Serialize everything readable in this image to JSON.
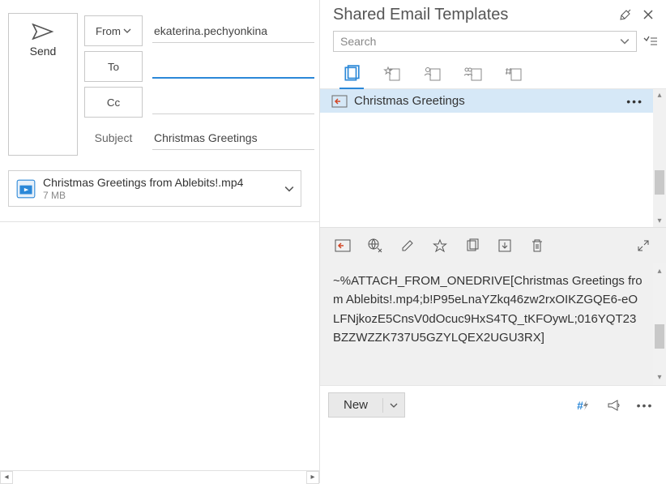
{
  "compose": {
    "send_label": "Send",
    "from_label": "From",
    "from_value": "ekaterina.pechyonkina",
    "to_label": "To",
    "to_value": "",
    "cc_label": "Cc",
    "cc_value": "",
    "subject_label": "Subject",
    "subject_value": "Christmas Greetings",
    "attachment": {
      "name": "Christmas Greetings from Ablebits!.mp4",
      "size": "7 MB"
    }
  },
  "panel": {
    "title": "Shared Email Templates",
    "search_placeholder": "Search",
    "template_name": "Christmas Greetings",
    "preview_text": "~%ATTACH_FROM_ONEDRIVE[Christmas Greetings from Ablebits!.mp4;b!P95eLnaYZkq46zw2rxOIKZGQE6-eOLFNjkozE5CnsV0dOcuc9HxS4TQ_tKFOywL;016YQT23BZZWZZK737U5GZYLQEX2UGU3RX]",
    "new_label": "New",
    "hash_bolt": "#"
  }
}
